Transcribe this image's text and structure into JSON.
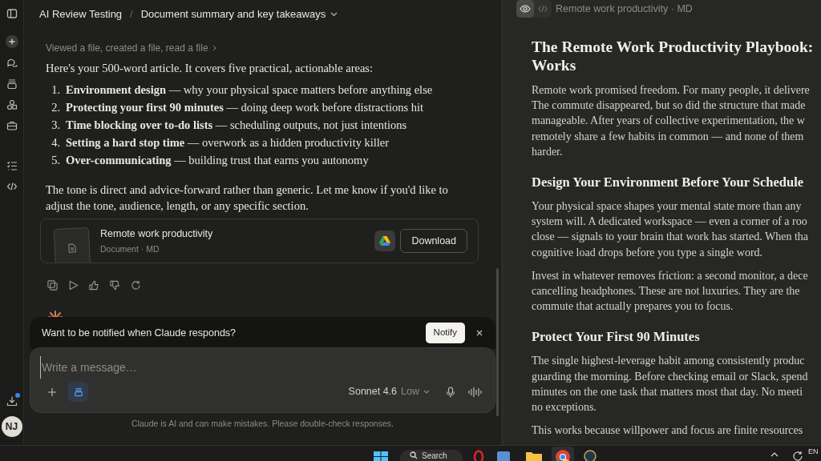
{
  "header": {
    "project": "AI Review Testing",
    "separator": "/",
    "chat_title": "Document summary and key takeaways"
  },
  "message": {
    "tool_summary": "Viewed a file, created a file, read a file",
    "intro": "Here's your 500-word article. It covers five practical, actionable areas:",
    "list": [
      {
        "number": "1.",
        "text": "**Environment design** — why your physical space matters before anything else"
      },
      {
        "number": "2.",
        "text": "**Protecting your first 90 minutes** — doing deep work before distractions hit"
      },
      {
        "number": "3.",
        "text": "**Time blocking over to-do lists** — scheduling outputs, not just intentions"
      },
      {
        "number": "4.",
        "text": "**Setting a hard stop time** — overwork as a hidden productivity killer"
      },
      {
        "number": "5.",
        "text": "**Over-communicating** — building trust that earns you autonomy"
      }
    ],
    "closing": "The tone is direct and advice-forward rather than generic. Let me know if you'd like to adjust the tone, audience, length, or any specific section."
  },
  "attachment": {
    "title": "Remote work productivity",
    "meta": "Document · MD",
    "button": "Download"
  },
  "notify_banner": {
    "text": "Want to be notified when Claude responds?",
    "button": "Notify"
  },
  "composer": {
    "placeholder": "Write a message…",
    "model": "Sonnet 4.6",
    "effort": "Low"
  },
  "disclaimer": "Claude is AI and can make mistakes. Please double-check responses.",
  "avatar": "NJ",
  "preview": {
    "view_tabs": [
      {
        "kind": "preview",
        "selected": true
      },
      {
        "kind": "code",
        "selected": false
      }
    ],
    "file_label": "Remote work productivity · MD",
    "blocks": [
      {
        "kind": "h1",
        "lines": [
          "The Remote Work Productivity Playbook:",
          "Works"
        ]
      },
      {
        "kind": "p",
        "lines": [
          "Remote work promised freedom. For many people, it delivere",
          "The commute disappeared, but so did the structure that made",
          "manageable. After years of collective experimentation, the w",
          "remotely share a few habits in common — and none of them",
          "harder."
        ]
      },
      {
        "kind": "h2",
        "lines": [
          "Design Your Environment Before Your Schedule"
        ]
      },
      {
        "kind": "p",
        "lines": [
          "Your physical space shapes your mental state more than any",
          "system will. A dedicated workspace — even a corner of a roo",
          "close — signals to your brain that work has started. When tha",
          "cognitive load drops before you type a single word."
        ]
      },
      {
        "kind": "p",
        "lines": [
          "Invest in whatever removes friction: a second monitor, a dece",
          "cancelling headphones. These are not luxuries. They are the",
          "commute that actually prepares you to focus."
        ]
      },
      {
        "kind": "h2",
        "lines": [
          "Protect Your First 90 Minutes"
        ]
      },
      {
        "kind": "p",
        "lines": [
          "The single highest-leverage habit among consistently produc",
          "guarding the morning. Before checking email or Slack, spend",
          "minutes on the one task that matters most that day. No meeti",
          "no exceptions."
        ]
      },
      {
        "kind": "p",
        "lines": [
          "This works because willpower and focus are finite resources"
        ]
      }
    ]
  },
  "taskbar": {
    "search": "Search",
    "language": "EN"
  }
}
